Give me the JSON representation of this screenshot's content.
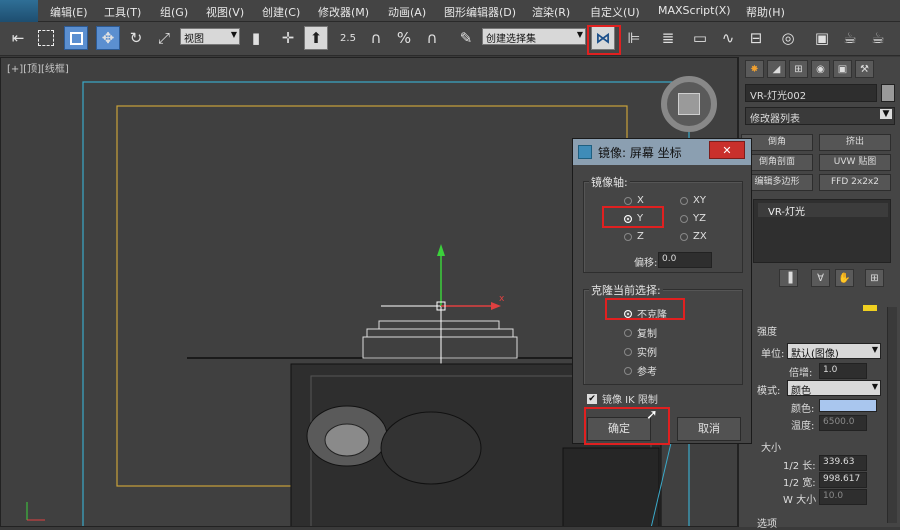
{
  "app": {
    "menus": [
      "编辑(E)",
      "工具(T)",
      "组(G)",
      "视图(V)",
      "创建(C)",
      "修改器(M)",
      "动画(A)",
      "图形编辑器(D)",
      "渲染(R)",
      "自定义(U)",
      "MAXScript(X)",
      "帮助(H)"
    ]
  },
  "toolbar": {
    "view_dropdown": "视图",
    "selection_set_dropdown": "创建选择集",
    "snap_value": "2.5"
  },
  "viewport": {
    "label": "[+][顶][线框]",
    "axis_x": "x"
  },
  "panel": {
    "object_name": "VR-灯光002",
    "modifier_list": "修改器列表",
    "mod_buttons": [
      "倒角",
      "挤出",
      "倒角剖面",
      "UVW 贴图",
      "编辑多边形",
      "FFD 2x2x2"
    ],
    "stack_item": "VR-灯光",
    "section_intensity": "强度",
    "units_label": "单位:",
    "units_value": "默认(图像)",
    "multiplier_label": "倍增:",
    "multiplier_value": "1.0",
    "mode_label": "模式:",
    "mode_value": "颜色",
    "color_label": "颜色:",
    "color_swatch": "#a9c6ee",
    "temp_label": "温度:",
    "temp_value": "6500.0",
    "section_size": "大小",
    "half_length_label": "1/2 长:",
    "half_length_value": "339.63",
    "half_width_label": "1/2 宽:",
    "half_width_value": "998.617",
    "w_size_label": "W 大小",
    "w_size_value": "10.0",
    "section_options": "选项"
  },
  "dialog": {
    "title": "镜像: 屏幕 坐标",
    "close": "✕",
    "mirror_axis_group": "镜像轴:",
    "axes": [
      {
        "label": "X",
        "selected": false
      },
      {
        "label": "Y",
        "selected": true
      },
      {
        "label": "Z",
        "selected": false
      },
      {
        "label": "XY",
        "selected": false
      },
      {
        "label": "YZ",
        "selected": false
      },
      {
        "label": "ZX",
        "selected": false
      }
    ],
    "offset_label": "偏移:",
    "offset_value": "0.0",
    "clone_group": "克隆当前选择:",
    "clone_options": [
      {
        "label": "不克隆",
        "selected": true
      },
      {
        "label": "复制",
        "selected": false
      },
      {
        "label": "实例",
        "selected": false
      },
      {
        "label": "参考",
        "selected": false
      }
    ],
    "mirror_ik_label": "镜像 IK 限制",
    "mirror_ik_checked": true,
    "ok": "确定",
    "cancel": "取消"
  }
}
